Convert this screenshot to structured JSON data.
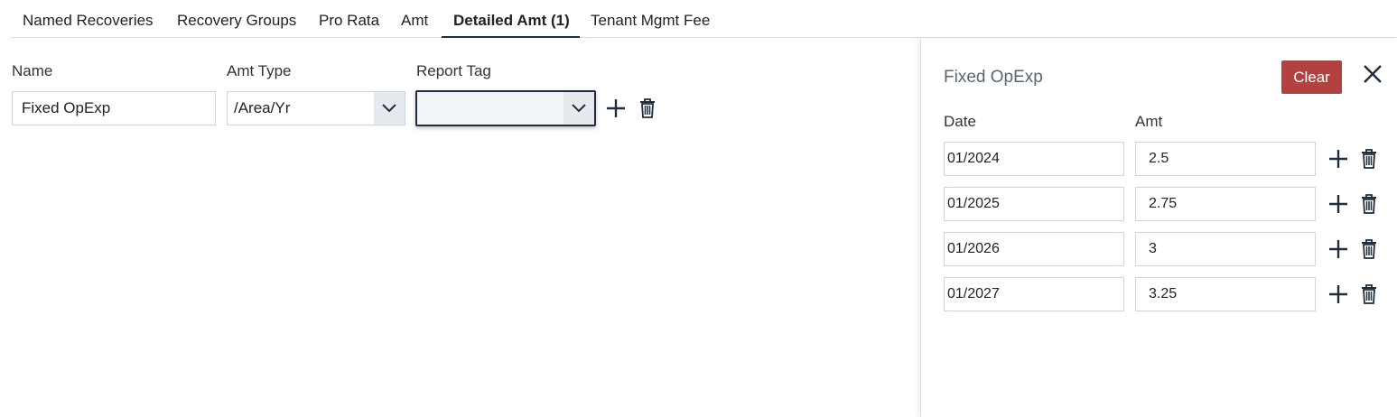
{
  "tabs": [
    {
      "label": "Named Recoveries"
    },
    {
      "label": "Recovery Groups"
    },
    {
      "label": "Pro Rata"
    },
    {
      "label": "Amt"
    },
    {
      "label": "Detailed Amt (1)",
      "active": true
    },
    {
      "label": "Tenant Mgmt Fee"
    }
  ],
  "form": {
    "name_label": "Name",
    "name_value": "Fixed OpExp",
    "amt_type_label": "Amt Type",
    "amt_type_value": "/Area/Yr",
    "report_tag_label": "Report Tag",
    "report_tag_value": ""
  },
  "panel": {
    "title": "Fixed OpExp",
    "clear_label": "Clear",
    "date_label": "Date",
    "amt_label": "Amt",
    "rows": [
      {
        "date": "01/2024",
        "amt": "2.5"
      },
      {
        "date": "01/2025",
        "amt": "2.75"
      },
      {
        "date": "01/2026",
        "amt": "3"
      },
      {
        "date": "01/2027",
        "amt": "3.25"
      }
    ]
  },
  "colors": {
    "accent": "#1f2d3d",
    "clear_button": "#b2413f",
    "panel_title": "#5a6675"
  },
  "icons": [
    "chevron-down-icon",
    "plus-icon",
    "trash-icon",
    "close-icon"
  ]
}
